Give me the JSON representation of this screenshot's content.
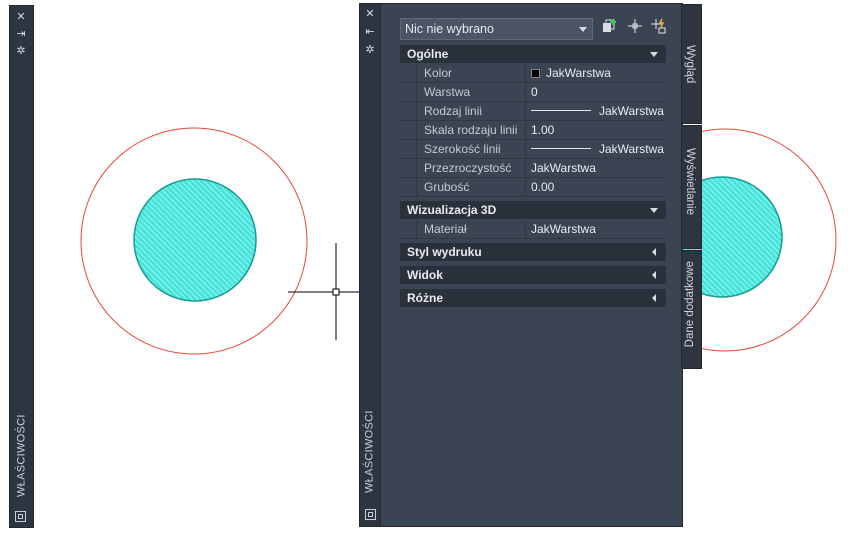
{
  "left_palette": {
    "title": "WŁAŚCIWOŚCI",
    "icons": [
      "close-icon",
      "auto-hide-icon",
      "settings-icon",
      "menu-icon"
    ]
  },
  "properties": {
    "title": "WŁAŚCIWOŚCI",
    "selection": "Nic nie wybrano",
    "tools": [
      "toggle-pickadd-icon",
      "select-objects-icon",
      "quick-select-icon"
    ],
    "sections": {
      "general": {
        "label": "Ogólne",
        "rows": [
          {
            "name": "Kolor",
            "value": "JakWarstwa"
          },
          {
            "name": "Warstwa",
            "value": "0"
          },
          {
            "name": "Rodzaj linii",
            "value": "JakWarstwa"
          },
          {
            "name": "Skala rodzaju linii",
            "value": "1.00"
          },
          {
            "name": "Szerokość linii",
            "value": "JakWarstwa"
          },
          {
            "name": "Przezroczystość",
            "value": "JakWarstwa"
          },
          {
            "name": "Grubość",
            "value": "0.00"
          }
        ]
      },
      "visual3d": {
        "label": "Wizualizacja 3D",
        "rows": [
          {
            "name": "Materiał",
            "value": "JakWarstwa"
          }
        ]
      },
      "plot_style": {
        "label": "Styl wydruku"
      },
      "view": {
        "label": "Widok"
      },
      "misc": {
        "label": "Różne"
      }
    }
  },
  "tabs": {
    "appearance": "Wygląd",
    "display": "Wyświetlanie",
    "extra": "Dane dodatkowe"
  },
  "colors": {
    "circle_outer": "#e8473c",
    "hatch_fill": "#3fe3db",
    "hatch_edge": "#16a39b",
    "palette_bg": "#3b4453"
  }
}
